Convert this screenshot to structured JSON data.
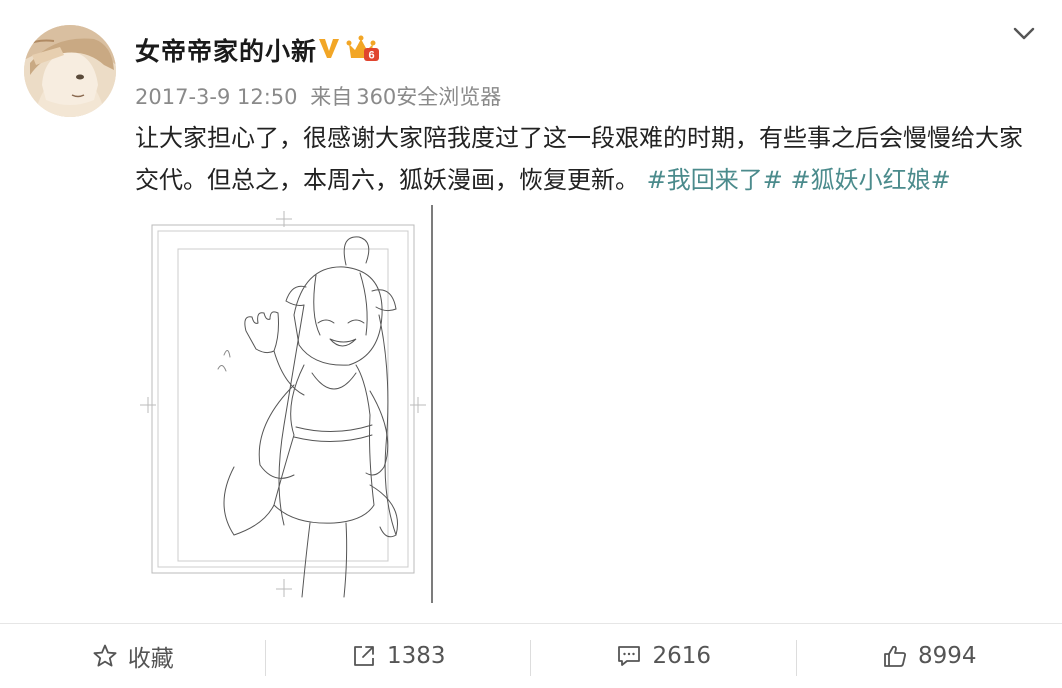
{
  "post": {
    "username": "女帝帝家的小新",
    "meta": {
      "timestamp": "2017-3-9 12:50",
      "source_prefix": "来自",
      "source": "360安全浏览器"
    },
    "content": {
      "text": "让大家担心了，很感谢大家陪我度过了这一段艰难的时期，有些事之后会慢慢给大家交代。但总之，本周六，狐妖漫画，恢复更新。",
      "hashtag_1": "#我回来了#",
      "hashtag_2": "#狐妖小红娘#"
    },
    "image": {
      "description_icon": "sketch-image"
    },
    "badges": {
      "verified_icon": "verified-v-icon",
      "crown_icon": "crown-level-icon",
      "crown_label": "6"
    }
  },
  "actions": {
    "favorite": {
      "icon": "star-icon",
      "label": "收藏"
    },
    "repost": {
      "icon": "share-icon",
      "count": "1383"
    },
    "comment": {
      "icon": "comment-icon",
      "count": "2616"
    },
    "like": {
      "icon": "thumbs-up-icon",
      "count": "8994"
    }
  },
  "colors": {
    "hashtag": "#4b8b8c",
    "meta": "#8a8a8a",
    "verified": "#f2a626",
    "crown": "#f2a626"
  }
}
